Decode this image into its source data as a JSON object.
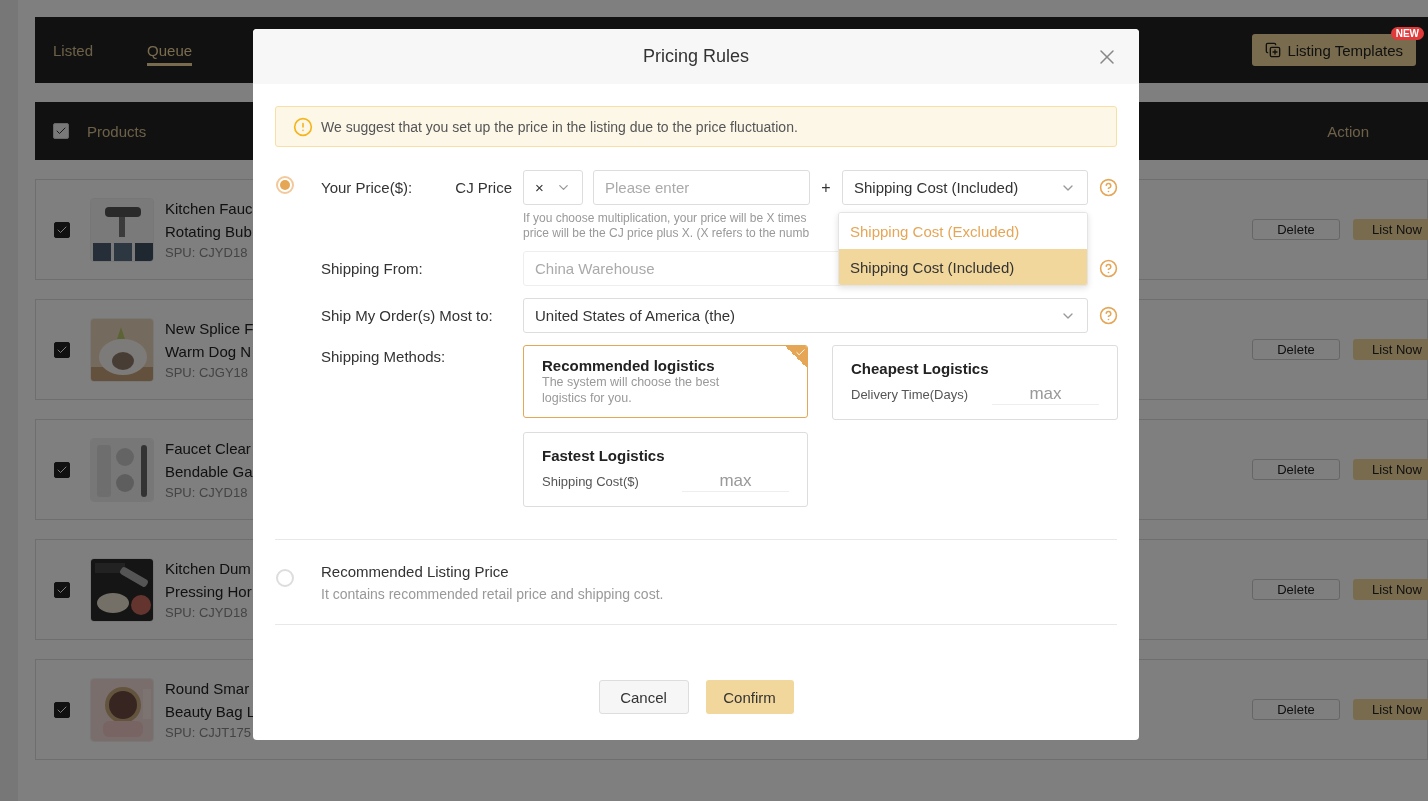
{
  "tabs": [
    {
      "label": "Listed",
      "selected": false
    },
    {
      "label": "Queue",
      "selected": true
    }
  ],
  "templates_button": {
    "label": "Listing Templates",
    "badge": "NEW"
  },
  "table": {
    "select_all": {
      "checked": true
    },
    "columns": [
      "Products",
      "Action"
    ],
    "rows": [
      {
        "checked": true,
        "title_lines": [
          "Kitchen Fauc",
          "Rotating Bub"
        ],
        "spu": "SPU: CJYD18",
        "actions": [
          "Delete",
          "List Now"
        ]
      },
      {
        "checked": true,
        "title_lines": [
          "New Splice F",
          "Warm Dog N"
        ],
        "spu": "SPU: CJGY18",
        "actions": [
          "Delete",
          "List Now"
        ]
      },
      {
        "checked": true,
        "title_lines": [
          "Faucet Clear",
          "Bendable Ga"
        ],
        "spu": "SPU: CJYD18",
        "actions": [
          "Delete",
          "List Now"
        ]
      },
      {
        "checked": true,
        "title_lines": [
          "Kitchen Dum",
          "Pressing Hor"
        ],
        "spu": "SPU: CJYD18",
        "actions": [
          "Delete",
          "List Now"
        ]
      },
      {
        "checked": true,
        "title_lines": [
          "Round Smar",
          "Beauty Bag L"
        ],
        "spu": "SPU: CJJT175",
        "actions": [
          "Delete",
          "List Now"
        ]
      }
    ]
  },
  "dialog": {
    "title": "Pricing Rules",
    "notice": "We suggest that you set up the price in the listing due to the price fluctuation.",
    "options": [
      {
        "kind": "custom",
        "selected": true,
        "price_label": "Your Price($):",
        "base_label": "CJ Price",
        "operator": "×",
        "amount_placeholder": "Please enter",
        "plus": "+",
        "shipping_select": {
          "value": "Shipping Cost (Included)",
          "expanded": true,
          "options": [
            {
              "label": "Shipping Cost (Excluded)",
              "selected": false
            },
            {
              "label": "Shipping Cost (Included)",
              "selected": true
            }
          ]
        },
        "hint_lines": [
          "If you choose multiplication, your price will be X times",
          "price will be the CJ price plus X. (X refers to the numb"
        ],
        "shipping_from": {
          "label": "Shipping From:",
          "value": "China Warehouse",
          "disabled": true
        },
        "ship_to": {
          "label": "Ship My Order(s) Most to:",
          "value": "United States of America (the)"
        },
        "methods": {
          "label": "Shipping Methods:",
          "cards": [
            {
              "kind": "auto",
              "title": "Recommended logistics",
              "description": "The system will choose the best logistics for you.",
              "selected": true
            },
            {
              "kind": "limit",
              "title": "Cheapest Logistics",
              "field_label": "Delivery Time(Days)",
              "placeholder": "max",
              "selected": false
            },
            {
              "kind": "limit",
              "title": "Fastest Logistics",
              "field_label": "Shipping Cost($)",
              "placeholder": "max",
              "selected": false
            }
          ]
        }
      },
      {
        "kind": "recommended",
        "selected": false,
        "title": "Recommended Listing Price",
        "description": "It contains recommended retail price and shipping cost."
      }
    ],
    "buttons": [
      "Cancel",
      "Confirm"
    ]
  }
}
